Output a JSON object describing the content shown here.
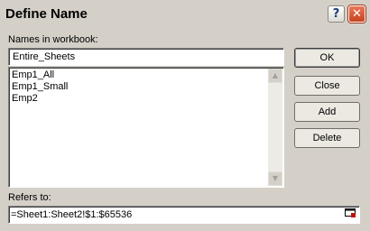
{
  "window": {
    "title": "Define Name",
    "help_glyph": "?",
    "close_glyph": "✕"
  },
  "names_label": "Names in workbook:",
  "name_value": "Entire_Sheets",
  "names_list": [
    "Emp1_All",
    "Emp1_Small",
    "Emp2"
  ],
  "buttons": {
    "ok": "OK",
    "close": "Close",
    "add": "Add",
    "delete": "Delete"
  },
  "refers_label": "Refers to:",
  "refers_value": "=Sheet1:Sheet2!$1:$65536",
  "icons": {
    "scroll_up": "up-arrow",
    "scroll_down": "down-arrow",
    "collapse": "collapse-dialog"
  }
}
